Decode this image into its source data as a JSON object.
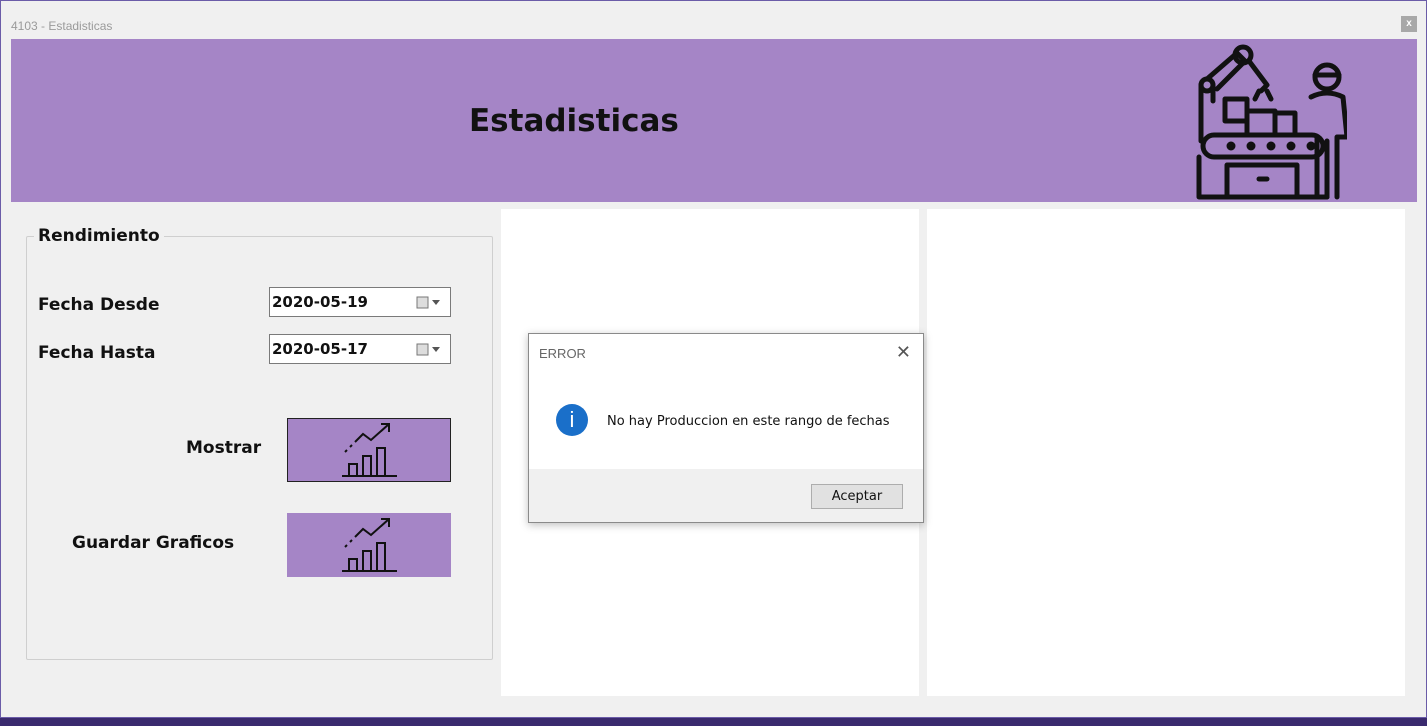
{
  "window": {
    "title": "4103 - Estadisticas",
    "close_label": "x"
  },
  "header": {
    "title": "Estadisticas",
    "logo_icon": "factory-robot-arm-worker-icon"
  },
  "group": {
    "legend": "Rendimiento",
    "fecha_desde_label": "Fecha Desde",
    "fecha_desde_value": "2020-05-19",
    "fecha_hasta_label": "Fecha Hasta",
    "fecha_hasta_value": "2020-05-17",
    "mostrar_label": "Mostrar",
    "guardar_label": "Guardar Graficos",
    "button_icon": "growth-chart-icon"
  },
  "dialog": {
    "title": "ERROR",
    "close_symbol": "✕",
    "icon": "info-icon",
    "icon_glyph": "i",
    "message": "No hay Produccion en este rango de fechas",
    "ok_label": "Aceptar"
  },
  "colors": {
    "accent": "#a585c6",
    "background": "#f0f0f0",
    "info": "#1a6fc9"
  }
}
